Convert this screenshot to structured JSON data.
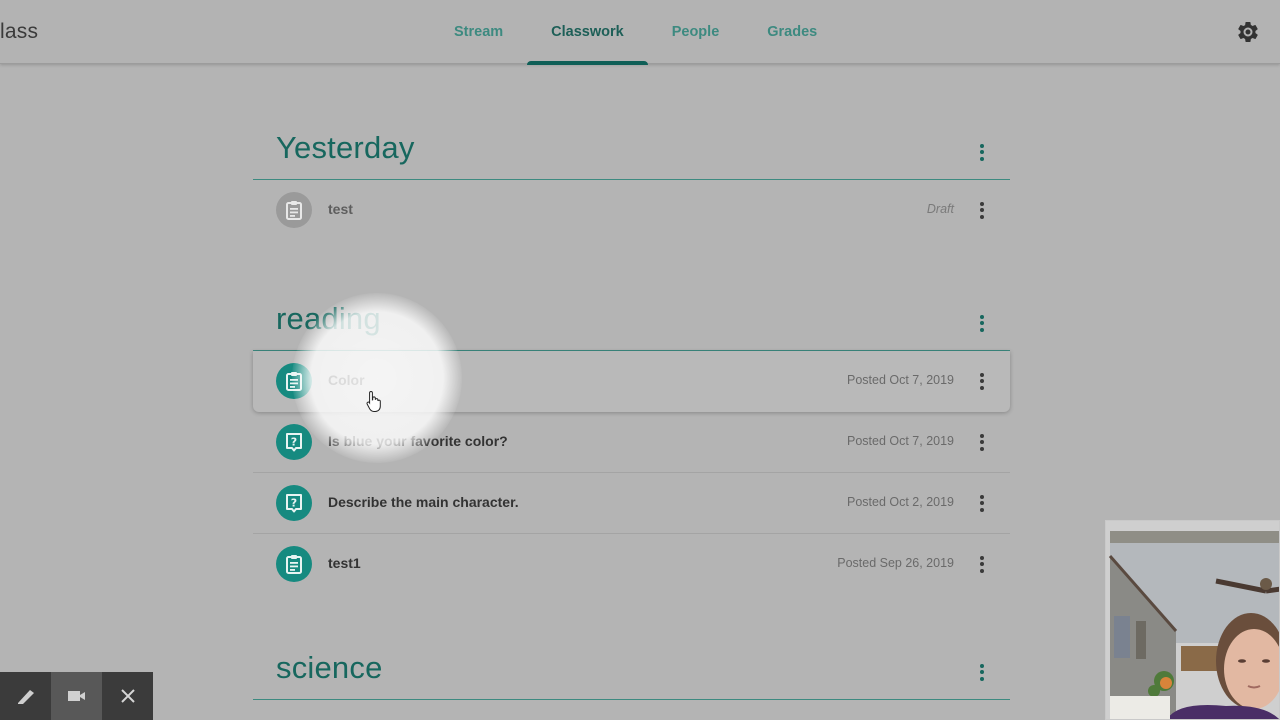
{
  "header": {
    "class_name": "lass",
    "tabs": [
      {
        "label": "Stream",
        "active": false
      },
      {
        "label": "Classwork",
        "active": true
      },
      {
        "label": "People",
        "active": false
      },
      {
        "label": "Grades",
        "active": false
      }
    ],
    "settings_icon": "gear-icon"
  },
  "sections": [
    {
      "title": "Yesterday",
      "items": [
        {
          "title": "test",
          "meta": "Draft",
          "type": "assignment",
          "draft": true
        }
      ]
    },
    {
      "title": "reading",
      "items": [
        {
          "title": "Color",
          "meta": "Posted Oct 7, 2019",
          "type": "assignment",
          "hovered": true
        },
        {
          "title": "Is blue your favorite color?",
          "meta": "Posted Oct 7, 2019",
          "type": "question"
        },
        {
          "title": "Describe the main character.",
          "meta": "Posted Oct 2, 2019",
          "type": "question"
        },
        {
          "title": "test1",
          "meta": "Posted Sep 26, 2019",
          "type": "assignment"
        }
      ]
    },
    {
      "title": "science",
      "items": []
    }
  ],
  "recorder_toolbar": {
    "tools": [
      "pen-icon",
      "camera-icon",
      "close-icon"
    ],
    "active_tool": "camera-icon"
  },
  "colors": {
    "accent": "#17675e",
    "icon_bg": "#168a80",
    "tab_indicator": "#0f5f57"
  }
}
